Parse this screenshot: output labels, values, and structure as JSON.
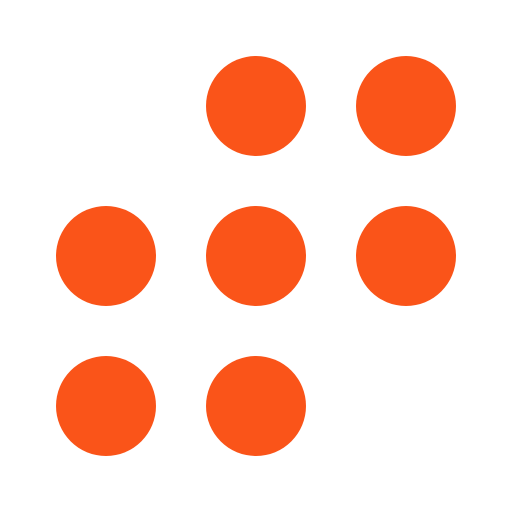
{
  "logo": {
    "name": "dot-grid-logo",
    "dot_color": "#fa5419",
    "background_color": "#ffffff",
    "grid": {
      "rows": 3,
      "columns": 3
    },
    "filled_cells": [
      {
        "row": 1,
        "col": 2
      },
      {
        "row": 1,
        "col": 3
      },
      {
        "row": 2,
        "col": 1
      },
      {
        "row": 2,
        "col": 2
      },
      {
        "row": 2,
        "col": 3
      },
      {
        "row": 3,
        "col": 1
      },
      {
        "row": 3,
        "col": 2
      }
    ]
  }
}
